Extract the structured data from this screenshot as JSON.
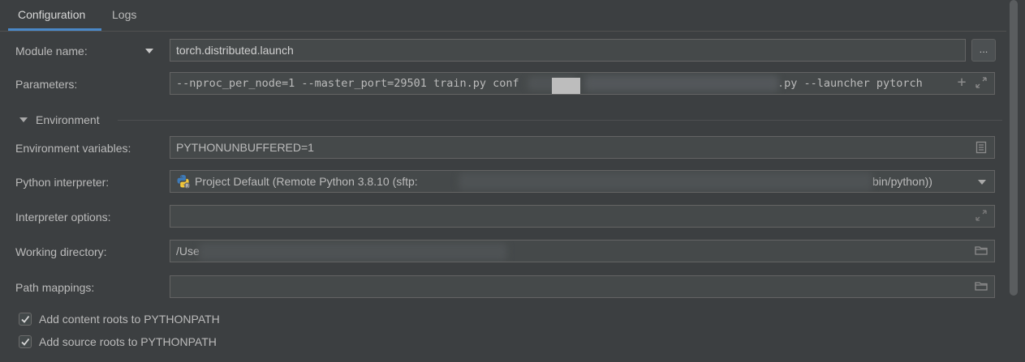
{
  "tabs": [
    {
      "label": "Configuration",
      "active": true
    },
    {
      "label": "Logs",
      "active": false
    }
  ],
  "module_name": {
    "label": "Module name:",
    "value": "torch.distributed.launch",
    "browse_label": "..."
  },
  "parameters": {
    "label": "Parameters:",
    "value_start": "--nproc_per_node=1 --master_port=29501 train.py conf",
    "value_end": ".py --launcher pytorch"
  },
  "environment": {
    "section_title": "Environment",
    "env_vars": {
      "label": "Environment variables:",
      "value": "PYTHONUNBUFFERED=1"
    },
    "interpreter": {
      "label": "Python interpreter:",
      "value_start": "Project Default (Remote Python 3.8.10 (sftp:",
      "value_end": "bin/python))"
    },
    "interpreter_options": {
      "label": "Interpreter options:",
      "value": ""
    },
    "working_directory": {
      "label": "Working directory:",
      "value": "/Use"
    },
    "path_mappings": {
      "label": "Path mappings:",
      "value": ""
    }
  },
  "checkboxes": [
    {
      "label": "Add content roots to PYTHONPATH",
      "checked": true
    },
    {
      "label": "Add source roots to PYTHONPATH",
      "checked": true
    }
  ],
  "colors": {
    "background": "#3c3f41",
    "field_bg": "#45494a",
    "accent": "#4a88c7",
    "text": "#bbbbbb"
  }
}
